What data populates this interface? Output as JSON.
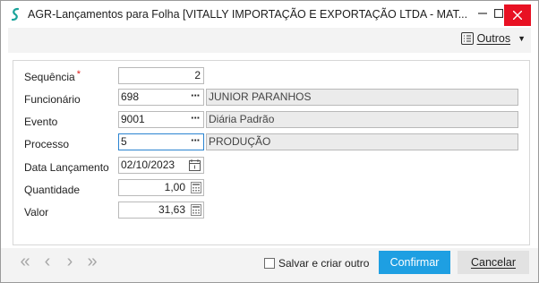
{
  "window": {
    "title": "AGR-Lançamentos para Folha [VITALLY IMPORTAÇÃO E EXPORTAÇÃO LTDA - MAT...",
    "minimize_label": "–",
    "maximize_label": "□",
    "close_label": "✕"
  },
  "toolbar": {
    "outros_label": "Outros",
    "outros_caret": "▼"
  },
  "form": {
    "sequencia": {
      "label": "Sequência",
      "required_mark": "*",
      "value": "2"
    },
    "funcionario": {
      "label": "Funcionário",
      "value": "698",
      "description": "JUNIOR PARANHOS"
    },
    "evento": {
      "label": "Evento",
      "value": "9001",
      "description": "Diária Padrão"
    },
    "processo": {
      "label": "Processo",
      "value": "5",
      "description": "PRODUÇÃO"
    },
    "data_lancamento": {
      "label": "Data Lançamento",
      "value": "02/10/2023"
    },
    "quantidade": {
      "label": "Quantidade",
      "value": "1,00"
    },
    "valor": {
      "label": "Valor",
      "value": "31,63"
    },
    "lookup_icon_text": "···"
  },
  "footer": {
    "nav": {
      "first": "«",
      "prev": "‹",
      "next": "›",
      "last": "»"
    },
    "save_and_create_label": "Salvar e criar outro",
    "confirm_label": "Confirmar",
    "cancel_label": "Cancelar"
  },
  "colors": {
    "confirm_bg": "#1e9fe2",
    "close_bg": "#e81123",
    "focus_border": "#2b84d1",
    "required": "#e0201d"
  }
}
